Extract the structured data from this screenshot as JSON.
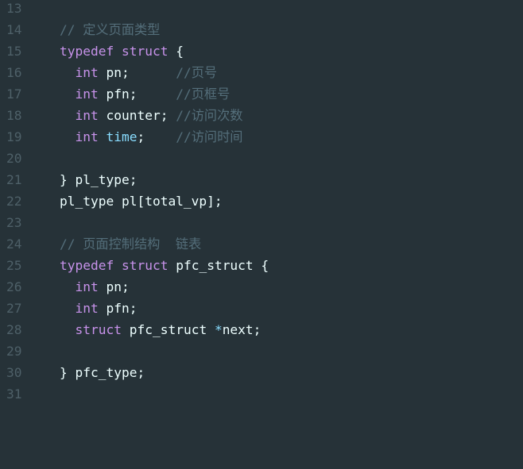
{
  "lines": [
    {
      "num": "13",
      "code": ""
    },
    {
      "num": "14",
      "code": "// 定义页面类型"
    },
    {
      "num": "15",
      "code": "typedef struct {"
    },
    {
      "num": "16",
      "code": "  int pn;      //页号"
    },
    {
      "num": "17",
      "code": "  int pfn;     //页框号"
    },
    {
      "num": "18",
      "code": "  int counter; //访问次数"
    },
    {
      "num": "19",
      "code": "  int time;    //访问时间"
    },
    {
      "num": "20",
      "code": ""
    },
    {
      "num": "21",
      "code": "} pl_type;"
    },
    {
      "num": "22",
      "code": "pl_type pl[total_vp];"
    },
    {
      "num": "23",
      "code": ""
    },
    {
      "num": "24",
      "code": "// 页面控制结构  链表"
    },
    {
      "num": "25",
      "code": "typedef struct pfc_struct {"
    },
    {
      "num": "26",
      "code": "  int pn;"
    },
    {
      "num": "27",
      "code": "  int pfn;"
    },
    {
      "num": "28",
      "code": "  struct pfc_struct *next;"
    },
    {
      "num": "29",
      "code": ""
    },
    {
      "num": "30",
      "code": "} pfc_type;"
    },
    {
      "num": "31",
      "code": ""
    }
  ],
  "tokens": {
    "c14": "// 定义页面类型",
    "typedef": "typedef",
    "struct": "struct",
    "int": "int",
    "l15_rest": " {",
    "l16_rest": " pn;      ",
    "l16_cmt": "//页号",
    "l17_rest": " pfn;     ",
    "l17_cmt": "//页框号",
    "l18_rest": " counter; ",
    "l18_cmt": "//访问次数",
    "l19_time": "time",
    "l19_rest": ";    ",
    "l19_cmt": "//访问时间",
    "l21": "} pl_type;",
    "l22": "pl_type pl[total_vp];",
    "c24": "// 页面控制结构  链表",
    "l25_rest": " pfc_struct {",
    "l26_rest": " pn;",
    "l27_rest": " pfn;",
    "l28_a": " pfc_struct ",
    "l28_star": "*",
    "l28_b": "next;",
    "l30": "} pfc_type;"
  },
  "colors": {
    "background": "#263238",
    "keyword": "#c792ea",
    "comment": "#546e7a",
    "property": "#89ddff",
    "text": "#eeffff",
    "line_number": "#4e6068"
  }
}
